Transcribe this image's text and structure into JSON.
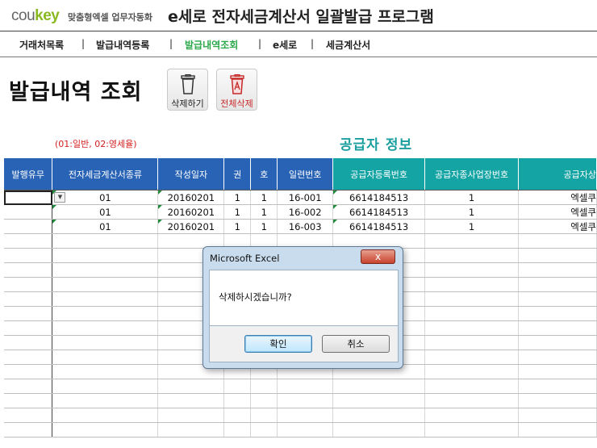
{
  "header": {
    "logo_main": "cou",
    "logo_accent": "key",
    "logo_sub": "맞춤형엑셀 업무자동화",
    "app_title": "e세로 전자세금계산서 일괄발급 프로그램"
  },
  "nav": {
    "items": [
      "거래처목록",
      "발급내역등록",
      "발급내역조회",
      "e세로",
      "세금계산서"
    ],
    "separator": "|",
    "active": "발급내역조회"
  },
  "page": {
    "title": "발급내역 조회",
    "delete_button": "삭제하기",
    "delete_all_button": "전체삭제",
    "type_note": "(01:일반, 02:영세율)",
    "supplier_section": "공급자 정보"
  },
  "colors": {
    "header_blue": "#2863b5",
    "header_teal": "#15a4a4",
    "active_nav": "#2aa84a",
    "note_red": "#d42020"
  },
  "icons": {
    "delete": "trash-icon",
    "delete_all": "trash-red-icon",
    "dropdown": "chevron-down-icon",
    "close": "close-icon"
  },
  "table": {
    "columns": [
      "발행유무",
      "전자세금계산서종류",
      "작성일자",
      "권",
      "호",
      "일련번호",
      "공급자등록번호",
      "공급자종사업장번호",
      "공급자상"
    ],
    "rows": [
      [
        "",
        "01",
        "20160201",
        "1",
        "1",
        "16-001",
        "6614184513",
        "1",
        "엑셀쿠"
      ],
      [
        "",
        "01",
        "20160201",
        "1",
        "1",
        "16-002",
        "6614184513",
        "1",
        "엑셀쿠"
      ],
      [
        "",
        "01",
        "20160201",
        "1",
        "1",
        "16-003",
        "6614184513",
        "1",
        "엑셀쿠"
      ]
    ]
  },
  "dialog": {
    "title": "Microsoft Excel",
    "close": "x",
    "message": "삭제하시겠습니까?",
    "ok": "확인",
    "cancel": "취소"
  }
}
